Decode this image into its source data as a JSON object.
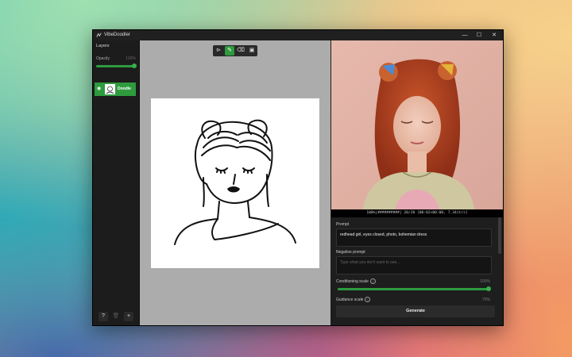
{
  "window": {
    "title": "VibeDoodler",
    "controls": {
      "minimize": "—",
      "maximize": "☐",
      "close": "✕"
    }
  },
  "layers_panel": {
    "header": "Layers",
    "opacity_label": "Opacity",
    "opacity_value": "100%",
    "opacity_fraction": 1.0,
    "layers": [
      {
        "name": "Doodle",
        "visible": true,
        "selected": true
      }
    ],
    "buttons": {
      "help": "?",
      "delete": "🗑",
      "add": "+"
    }
  },
  "toolbar": {
    "tools": [
      {
        "name": "select",
        "glyph": "⊳",
        "active": false
      },
      {
        "name": "pen",
        "glyph": "✎",
        "active": true
      },
      {
        "name": "eraser",
        "glyph": "⌫",
        "active": false
      },
      {
        "name": "image",
        "glyph": "▣",
        "active": false
      }
    ]
  },
  "output": {
    "progress_text": "100%|##########| 20/20 [00:02<00:00, 7.34it/s]"
  },
  "controls": {
    "prompt_label": "Prompt",
    "prompt_value": "redhead girl, eyes closed, photo, bohemian dress",
    "negative_label": "Negative prompt",
    "negative_placeholder": "Type what you don't want to see...",
    "conditioning_label": "Conditioning scale",
    "conditioning_value": "100%",
    "conditioning_fraction": 1.0,
    "guidance_label": "Guidance scale",
    "guidance_value": "70%",
    "generate_label": "Generate"
  },
  "colors": {
    "accent": "#2e9b3e",
    "window_bg": "#1e1e1e",
    "canvas_bg": "#acacac"
  }
}
